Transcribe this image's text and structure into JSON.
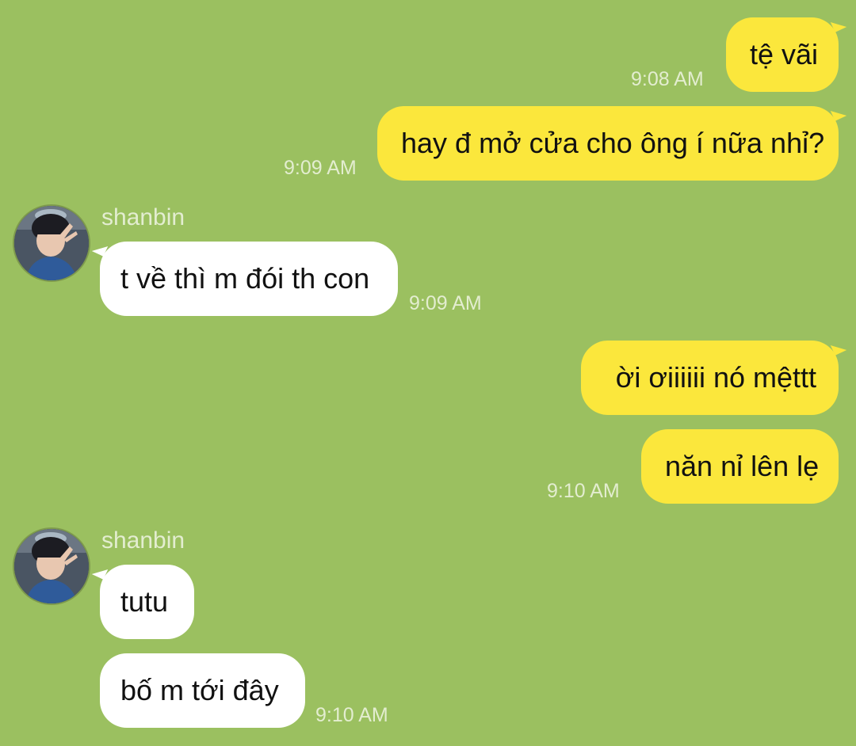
{
  "colors": {
    "background": "#9bc060",
    "outgoing_bubble": "#fbe73c",
    "incoming_bubble": "#ffffff",
    "meta_text": "#e3edd0"
  },
  "messages": [
    {
      "direction": "out",
      "text": "tệ vãi",
      "time": "9:08 AM"
    },
    {
      "direction": "out",
      "text": "hay đ mở cửa cho ông í nữa nhỉ?",
      "time": "9:09 AM"
    },
    {
      "direction": "in",
      "sender": "shanbin",
      "avatar_icon": "user-avatar-icon",
      "text": "t về thì m đói th con",
      "time": "9:09 AM"
    },
    {
      "direction": "out",
      "text": "ời ơiiiiii nó mệttt"
    },
    {
      "direction": "out",
      "text": "năn nỉ lên lẹ",
      "time": "9:10 AM"
    },
    {
      "direction": "in",
      "sender": "shanbin",
      "avatar_icon": "user-avatar-icon",
      "text": "tutu"
    },
    {
      "direction": "in",
      "text": "bố m tới đây",
      "time": "9:10 AM"
    }
  ]
}
